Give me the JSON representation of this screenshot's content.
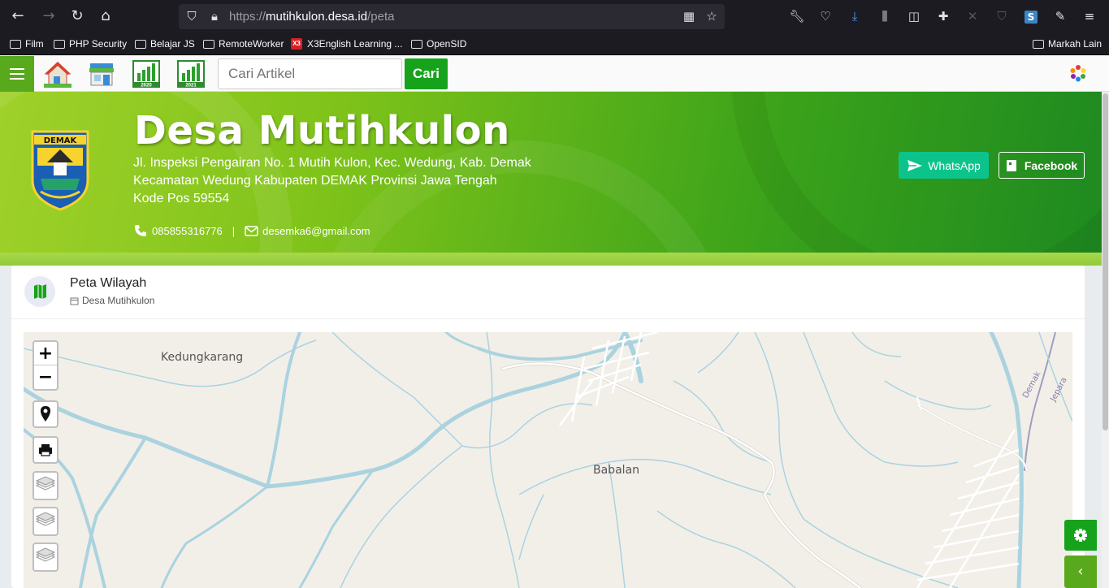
{
  "browser": {
    "url_prefix": "https://",
    "url_host": "mutihkulon.desa.id",
    "url_path": "/peta",
    "bookmarks": [
      "Film",
      "PHP Security",
      "Belajar JS",
      "RemoteWorker",
      "X3English Learning ...",
      "OpenSID"
    ],
    "other_bookmarks": "Markah Lain"
  },
  "nav": {
    "search_placeholder": "Cari Artikel",
    "search_button": "Cari",
    "year_2020": "2020",
    "year_2021": "2021"
  },
  "header": {
    "logo_text": "DEMAK",
    "title": "Desa Mutihkulon",
    "address_line1": "Jl. Inspeksi Pengairan No. 1 Mutih Kulon, Kec. Wedung, Kab. Demak",
    "address_line2": "Kecamatan Wedung Kabupaten DEMAK Provinsi Jawa Tengah",
    "address_line3": "Kode Pos 59554",
    "phone": "085855316776",
    "separator": "|",
    "email": "desemka6@gmail.com",
    "whatsapp_label": "WhatsApp",
    "facebook_label": "Facebook"
  },
  "card": {
    "title": "Peta Wilayah",
    "subtitle": "Desa Mutihkulon"
  },
  "map": {
    "labels": [
      "Kedungkarang",
      "Babalan",
      "Demak",
      "Jepara"
    ],
    "zoom_in": "+",
    "zoom_out": "−"
  },
  "colors": {
    "brand_green": "#17a21c",
    "whatsapp": "#0cc48b",
    "water": "#aad3df"
  }
}
